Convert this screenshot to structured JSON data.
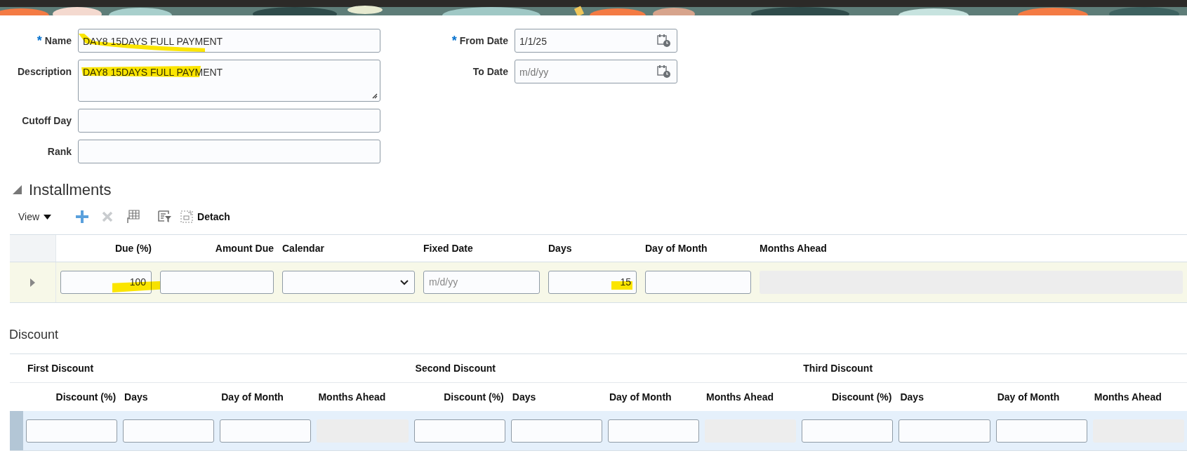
{
  "form": {
    "left": [
      {
        "kind": "text",
        "label": "Name",
        "required_mark": "*",
        "value": "DAY8 15DAYS FULL PAYMENT",
        "highlighted": true
      },
      {
        "kind": "textarea",
        "label": "Description",
        "value": "DAY8 15DAYS FULL PAYMENT",
        "highlighted": true
      },
      {
        "kind": "text",
        "label": "Cutoff Day"
      },
      {
        "kind": "text",
        "label": "Rank"
      }
    ],
    "right": [
      {
        "kind": "date",
        "label": "From Date",
        "required_mark": "*",
        "value": "1/1/25"
      },
      {
        "kind": "date",
        "label": "To Date",
        "placeholder": "m/d/yy"
      }
    ]
  },
  "installments": {
    "title": "Installments",
    "expanded": true,
    "toolbar": [
      {
        "kind": "menu",
        "label": "View"
      },
      {
        "kind": "add",
        "disabled": false
      },
      {
        "kind": "delete",
        "disabled": true
      },
      {
        "kind": "freeze",
        "disabled": false
      },
      {
        "kind": "filter",
        "disabled": false
      },
      {
        "kind": "detach",
        "label": "Detach",
        "disabled": false
      }
    ],
    "columns": [
      {
        "label": "Due (%)",
        "kind": "numeric"
      },
      {
        "label": "Amount Due",
        "kind": "numeric"
      },
      {
        "label": "Calendar",
        "kind": "text"
      },
      {
        "label": "Fixed Date",
        "kind": "text"
      },
      {
        "label": "Days",
        "kind": "text"
      },
      {
        "label": "Day of Month",
        "kind": "text"
      },
      {
        "label": "Months Ahead",
        "kind": "text"
      }
    ],
    "rows": [
      {
        "selected": true,
        "cells": [
          {
            "kind": "number",
            "value": "100",
            "highlighted": true
          },
          {
            "kind": "number"
          },
          {
            "kind": "select"
          },
          {
            "kind": "date",
            "placeholder": "m/d/yy"
          },
          {
            "kind": "number",
            "value": "15",
            "highlighted": true
          },
          {
            "kind": "number"
          },
          {
            "kind": "disabled"
          }
        ]
      }
    ]
  },
  "discount": {
    "title": "Discount",
    "groups": [
      {
        "label": "First Discount"
      },
      {
        "label": "Second Discount"
      },
      {
        "label": "Third Discount"
      }
    ],
    "columns": [
      {
        "label": "Discount (%)",
        "kind": "numeric"
      },
      {
        "label": "Days",
        "kind": "text"
      },
      {
        "label": "Day of Month",
        "kind": "text"
      },
      {
        "label": "Months Ahead",
        "kind": "text"
      },
      {
        "label": "Discount (%)",
        "kind": "numeric"
      },
      {
        "label": "Days",
        "kind": "text"
      },
      {
        "label": "Day of Month",
        "kind": "text"
      },
      {
        "label": "Months Ahead",
        "kind": "text"
      },
      {
        "label": "Discount (%)",
        "kind": "numeric"
      },
      {
        "label": "Days",
        "kind": "text"
      },
      {
        "label": "Day of Month",
        "kind": "text"
      },
      {
        "label": "Months Ahead",
        "kind": "text"
      }
    ],
    "rows": [
      {
        "selected": true,
        "cells": [
          {
            "kind": "number"
          },
          {
            "kind": "number"
          },
          {
            "kind": "number"
          },
          {
            "kind": "disabled"
          },
          {
            "kind": "number"
          },
          {
            "kind": "number"
          },
          {
            "kind": "number"
          },
          {
            "kind": "disabled"
          },
          {
            "kind": "number"
          },
          {
            "kind": "number"
          },
          {
            "kind": "number"
          },
          {
            "kind": "disabled"
          }
        ]
      }
    ]
  }
}
